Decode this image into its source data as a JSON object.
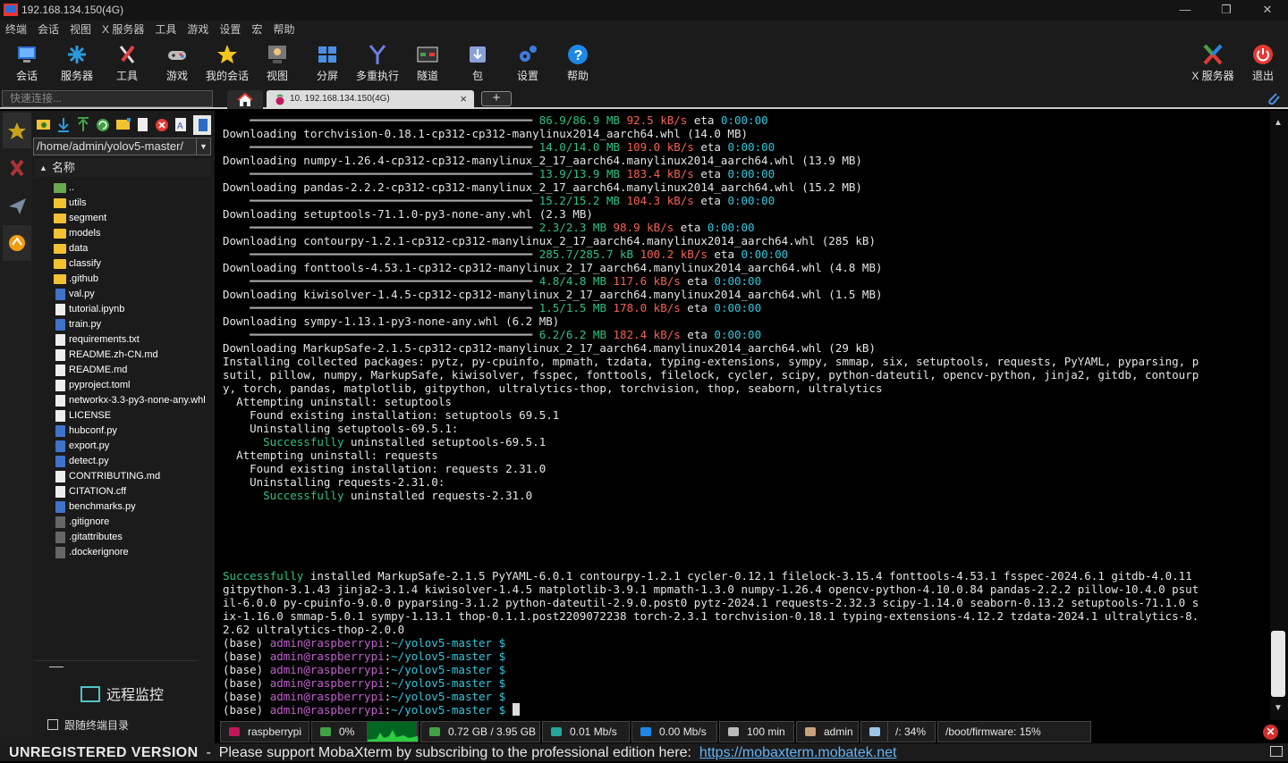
{
  "window": {
    "title": "192.168.134.150(4G)",
    "minimize": "—",
    "restore": "❐",
    "close": "✕"
  },
  "menubar": [
    "终端",
    "会话",
    "视图",
    "X 服务器",
    "工具",
    "游戏",
    "设置",
    "宏",
    "帮助"
  ],
  "toolbar": [
    {
      "label": "会话",
      "icon": "session-icon",
      "color": "#4a8fe0"
    },
    {
      "label": "服务器",
      "icon": "servers-icon",
      "color": "#2b9be0"
    },
    {
      "label": "工具",
      "icon": "tools-icon",
      "color": "#e04040"
    },
    {
      "label": "游戏",
      "icon": "games-icon",
      "color": "#bbbbbb"
    },
    {
      "label": "我的会话",
      "icon": "star-icon",
      "color": "#f5c518"
    },
    {
      "label": "视图",
      "icon": "view-icon",
      "color": "#aaaaaa"
    },
    {
      "label": "分屏",
      "icon": "split-icon",
      "color": "#4a90e2"
    },
    {
      "label": "多重执行",
      "icon": "multiexec-icon",
      "color": "#6f7fe8"
    },
    {
      "label": "隧道",
      "icon": "tunnel-icon",
      "color": "#43a047"
    },
    {
      "label": "包",
      "icon": "package-icon",
      "color": "#8aa0d8"
    },
    {
      "label": "设置",
      "icon": "settings-icon",
      "color": "#3d7be0"
    },
    {
      "label": "帮助",
      "icon": "help-icon",
      "color": "#1e88e5"
    }
  ],
  "toolbar_right": [
    {
      "label": "X 服务器",
      "icon": "xserver-icon"
    },
    {
      "label": "退出",
      "icon": "exit-icon"
    }
  ],
  "quick_connect": {
    "placeholder": "快速连接..."
  },
  "tabs": {
    "session_label": "10. 192.168.134.150(4G)",
    "close": "×",
    "add": "+"
  },
  "sftp": {
    "path": "/home/admin/yolov5-master/",
    "column_header": "名称",
    "files": [
      {
        "name": "..",
        "type": "up"
      },
      {
        "name": "utils",
        "type": "folder"
      },
      {
        "name": "segment",
        "type": "folder"
      },
      {
        "name": "models",
        "type": "folder"
      },
      {
        "name": "data",
        "type": "folder"
      },
      {
        "name": "classify",
        "type": "folder"
      },
      {
        "name": ".github",
        "type": "folder"
      },
      {
        "name": "val.py",
        "type": "py"
      },
      {
        "name": "tutorial.ipynb",
        "type": "file"
      },
      {
        "name": "train.py",
        "type": "py"
      },
      {
        "name": "requirements.txt",
        "type": "file"
      },
      {
        "name": "README.zh-CN.md",
        "type": "file"
      },
      {
        "name": "README.md",
        "type": "file"
      },
      {
        "name": "pyproject.toml",
        "type": "file"
      },
      {
        "name": "networkx-3.3-py3-none-any.whl",
        "type": "file"
      },
      {
        "name": "LICENSE",
        "type": "file"
      },
      {
        "name": "hubconf.py",
        "type": "py"
      },
      {
        "name": "export.py",
        "type": "py"
      },
      {
        "name": "detect.py",
        "type": "py"
      },
      {
        "name": "CONTRIBUTING.md",
        "type": "file"
      },
      {
        "name": "CITATION.cff",
        "type": "file"
      },
      {
        "name": "benchmarks.py",
        "type": "py"
      },
      {
        "name": ".gitignore",
        "type": "dot"
      },
      {
        "name": ".gitattributes",
        "type": "dot"
      },
      {
        "name": ".dockerignore",
        "type": "dot"
      }
    ],
    "remote_monitor": "远程监控",
    "follow_terminal": "跟随终端目录"
  },
  "terminal": {
    "progress": [
      {
        "size": "86.9/86.9 MB",
        "speed": "92.5 kB/s",
        "eta": "0:00:00"
      },
      {
        "size": "14.0/14.0 MB",
        "speed": "109.0 kB/s",
        "eta": "0:00:00"
      },
      {
        "size": "13.9/13.9 MB",
        "speed": "183.4 kB/s",
        "eta": "0:00:00"
      },
      {
        "size": "15.2/15.2 MB",
        "speed": "104.3 kB/s",
        "eta": "0:00:00"
      },
      {
        "size": "2.3/2.3 MB",
        "speed": "98.9 kB/s",
        "eta": "0:00:00"
      },
      {
        "size": "285.7/285.7 kB",
        "speed": "100.2 kB/s",
        "eta": "0:00:00"
      },
      {
        "size": "4.8/4.8 MB",
        "speed": "117.6 kB/s",
        "eta": "0:00:00"
      },
      {
        "size": "1.5/1.5 MB",
        "speed": "178.0 kB/s",
        "eta": "0:00:00"
      },
      {
        "size": "6.2/6.2 MB",
        "speed": "182.4 kB/s",
        "eta": "0:00:00"
      }
    ],
    "downloads": [
      "Downloading torchvision-0.18.1-cp312-cp312-manylinux2014_aarch64.whl (14.0 MB)",
      "Downloading numpy-1.26.4-cp312-cp312-manylinux_2_17_aarch64.manylinux2014_aarch64.whl (13.9 MB)",
      "Downloading pandas-2.2.2-cp312-cp312-manylinux_2_17_aarch64.manylinux2014_aarch64.whl (15.2 MB)",
      "Downloading setuptools-71.1.0-py3-none-any.whl (2.3 MB)",
      "Downloading contourpy-1.2.1-cp312-cp312-manylinux_2_17_aarch64.manylinux2014_aarch64.whl (285 kB)",
      "Downloading fonttools-4.53.1-cp312-cp312-manylinux_2_17_aarch64.manylinux2014_aarch64.whl (4.8 MB)",
      "Downloading kiwisolver-1.4.5-cp312-cp312-manylinux_2_17_aarch64.manylinux2014_aarch64.whl (1.5 MB)",
      "Downloading sympy-1.13.1-py3-none-any.whl (6.2 MB)",
      "Downloading MarkupSafe-2.1.5-cp312-cp312-manylinux_2_17_aarch64.manylinux2014_aarch64.whl (29 kB)"
    ],
    "installing": [
      "Installing collected packages: pytz, py-cpuinfo, mpmath, tzdata, typing-extensions, sympy, smmap, six, setuptools, requests, PyYAML, pyparsing, p",
      "sutil, pillow, numpy, MarkupSafe, kiwisolver, fsspec, fonttools, filelock, cycler, scipy, python-dateutil, opencv-python, jinja2, gitdb, contourp",
      "y, torch, pandas, matplotlib, gitpython, ultralytics-thop, torchvision, thop, seaborn, ultralytics"
    ],
    "uninstall": [
      {
        "indent": "  ",
        "text": "Attempting uninstall: setuptools"
      },
      {
        "indent": "    ",
        "text": "Found existing installation: setuptools 69.5.1"
      },
      {
        "indent": "    ",
        "text": "Uninstalling setuptools-69.5.1:"
      },
      {
        "indent": "      ",
        "ok": "Successfully",
        "text": " uninstalled setuptools-69.5.1"
      },
      {
        "indent": "  ",
        "text": "Attempting uninstall: requests"
      },
      {
        "indent": "    ",
        "text": "Found existing installation: requests 2.31.0"
      },
      {
        "indent": "    ",
        "text": "Uninstalling requests-2.31.0:"
      },
      {
        "indent": "      ",
        "ok": "Successfully",
        "text": " uninstalled requests-2.31.0"
      }
    ],
    "success_word": "Successfully",
    "success_lines": [
      " installed MarkupSafe-2.1.5 PyYAML-6.0.1 contourpy-1.2.1 cycler-0.12.1 filelock-3.15.4 fonttools-4.53.1 fsspec-2024.6.1 gitdb-4.0.11",
      "gitpython-3.1.43 jinja2-3.1.4 kiwisolver-1.4.5 matplotlib-3.9.1 mpmath-1.3.0 numpy-1.26.4 opencv-python-4.10.0.84 pandas-2.2.2 pillow-10.4.0 psut",
      "il-6.0.0 py-cpuinfo-9.0.0 pyparsing-3.1.2 python-dateutil-2.9.0.post0 pytz-2024.1 requests-2.32.3 scipy-1.14.0 seaborn-0.13.2 setuptools-71.1.0 s",
      "ix-1.16.0 smmap-5.0.1 sympy-1.13.1 thop-0.1.1.post2209072238 torch-2.3.1 torchvision-0.18.1 typing-extensions-4.12.2 tzdata-2024.1 ultralytics-8.",
      "2.62 ultralytics-thop-2.0.0"
    ],
    "prompt": {
      "env": "(base) ",
      "user": "admin@raspberrypi",
      "sep": ":",
      "path": "~/yolov5-master",
      "sym": " $",
      "count": 6
    }
  },
  "statusbar": [
    {
      "text": "raspberrypi",
      "icon": "raspberry-icon"
    },
    {
      "text": "0%",
      "icon": "cpu-icon"
    },
    {
      "text": "",
      "icon": "cpu-graph"
    },
    {
      "text": "0.72 GB / 3.95 GB",
      "icon": "memory-icon"
    },
    {
      "text": "0.01 Mb/s",
      "icon": "upload-icon"
    },
    {
      "text": "0.00 Mb/s",
      "icon": "download-icon"
    },
    {
      "text": "100 min",
      "icon": "uptime-icon"
    },
    {
      "text": "admin",
      "icon": "user-icon"
    },
    {
      "text": "",
      "icon": "disk-icon"
    },
    {
      "text": "/: 34%",
      "icon": ""
    },
    {
      "text": "/boot/firmware: 15%",
      "icon": ""
    }
  ],
  "banner": {
    "unregistered": "UNREGISTERED VERSION",
    "dash": "  -  ",
    "support": "Please support MobaXterm by subscribing to the professional edition here:  ",
    "link": "https://mobaxterm.mobatek.net"
  }
}
